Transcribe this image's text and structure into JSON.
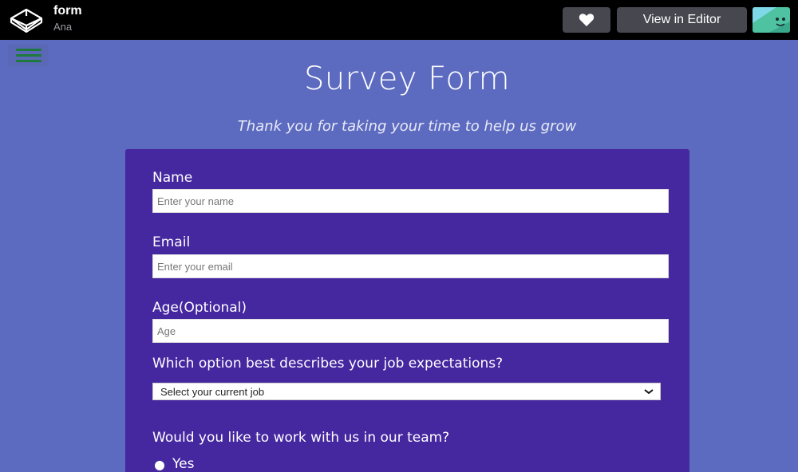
{
  "header": {
    "pen_title": "form",
    "author": "Ana",
    "view_editor_label": "View in Editor"
  },
  "page": {
    "title": "Survey Form",
    "subtitle": "Thank you for taking your time to help us grow"
  },
  "form": {
    "name_label": "Name",
    "name_placeholder": "Enter your name",
    "email_label": "Email",
    "email_placeholder": "Enter your email",
    "age_label": "Age(Optional)",
    "age_placeholder": "Age",
    "job_label": "Which option best describes your job expectations?",
    "job_selected": "Select your current job",
    "team_label": "Would you like to work with us in our team?",
    "team_option_yes": "Yes"
  },
  "icons": {
    "logo": "codepen-logo-icon",
    "heart": "heart-icon",
    "menu": "hamburger-menu-icon",
    "chevron": "chevron-down-icon"
  },
  "colors": {
    "page_background": "#5c6bc0",
    "form_background": "#4527a0",
    "topbar": "#000000",
    "button_background": "#47484f",
    "menu_bars": "#1e7a3c"
  }
}
